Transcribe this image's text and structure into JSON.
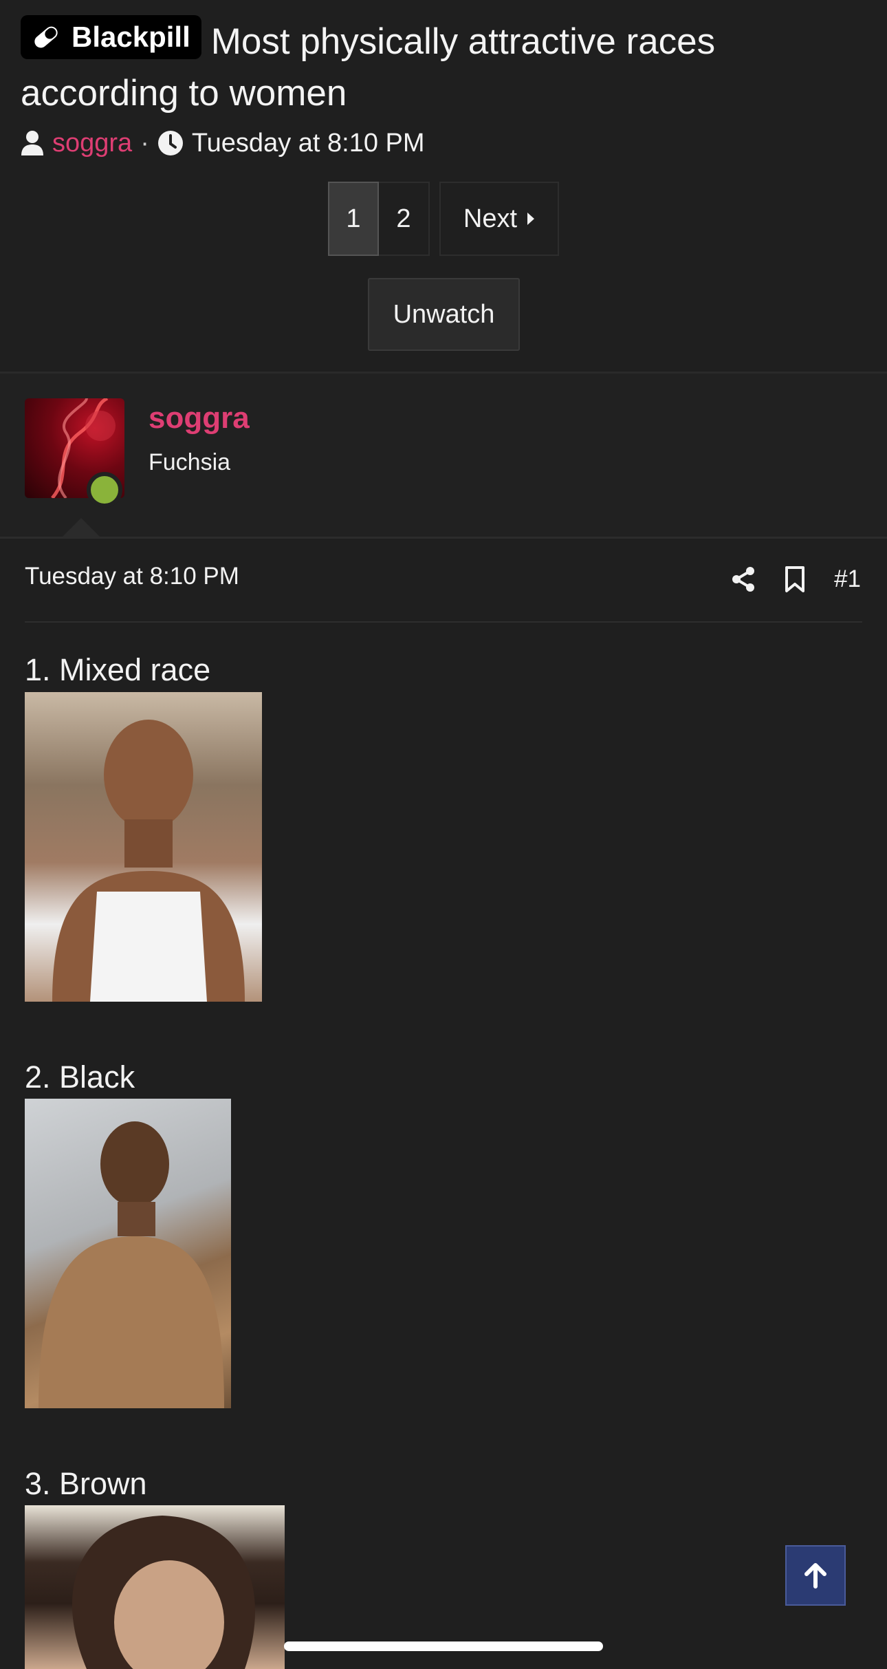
{
  "thread": {
    "prefix": "Blackpill",
    "title": "Most physically attractive races according to women",
    "author": "soggra",
    "separator": "·",
    "posted": "Tuesday at 8:10 PM"
  },
  "pagination": {
    "pages": [
      "1",
      "2"
    ],
    "current": "1",
    "next_label": "Next"
  },
  "watch_button": "Unwatch",
  "post": {
    "username": "soggra",
    "user_title": "Fuchsia",
    "online": true,
    "date": "Tuesday at 8:10 PM",
    "post_number": "#1",
    "entries": [
      {
        "label": "1. Mixed race"
      },
      {
        "label": "2. Black"
      },
      {
        "label": "3. Brown"
      }
    ]
  },
  "colors": {
    "background": "#1f1f1f",
    "accent_username": "#de3e73",
    "online_dot": "#8ab33a",
    "to_top_button": "#2b3b73"
  },
  "icons": [
    "blackpill-icon",
    "user-icon",
    "clock-icon",
    "caret-right-icon",
    "share-icon",
    "bookmark-icon",
    "arrow-up-icon"
  ]
}
